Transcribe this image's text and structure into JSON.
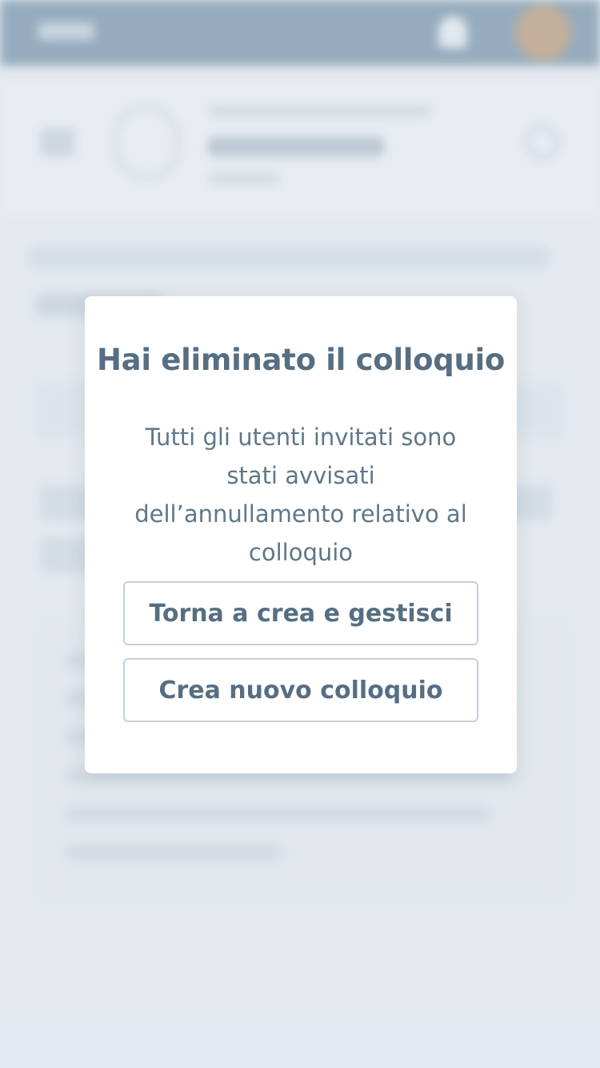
{
  "modal": {
    "title": "Hai eliminato il colloquio",
    "message": "Tutti gli utenti invitati sono stati avvisati dell’annullamento relativo al colloquio",
    "buttons": {
      "back": "Torna a crea e gestisci",
      "new": "Crea nuovo colloquio"
    }
  },
  "colors": {
    "topbar": "#6b8aa3",
    "text": "#566e82",
    "button_border": "#c4d0dc",
    "page_background": "#e3e8ef"
  }
}
